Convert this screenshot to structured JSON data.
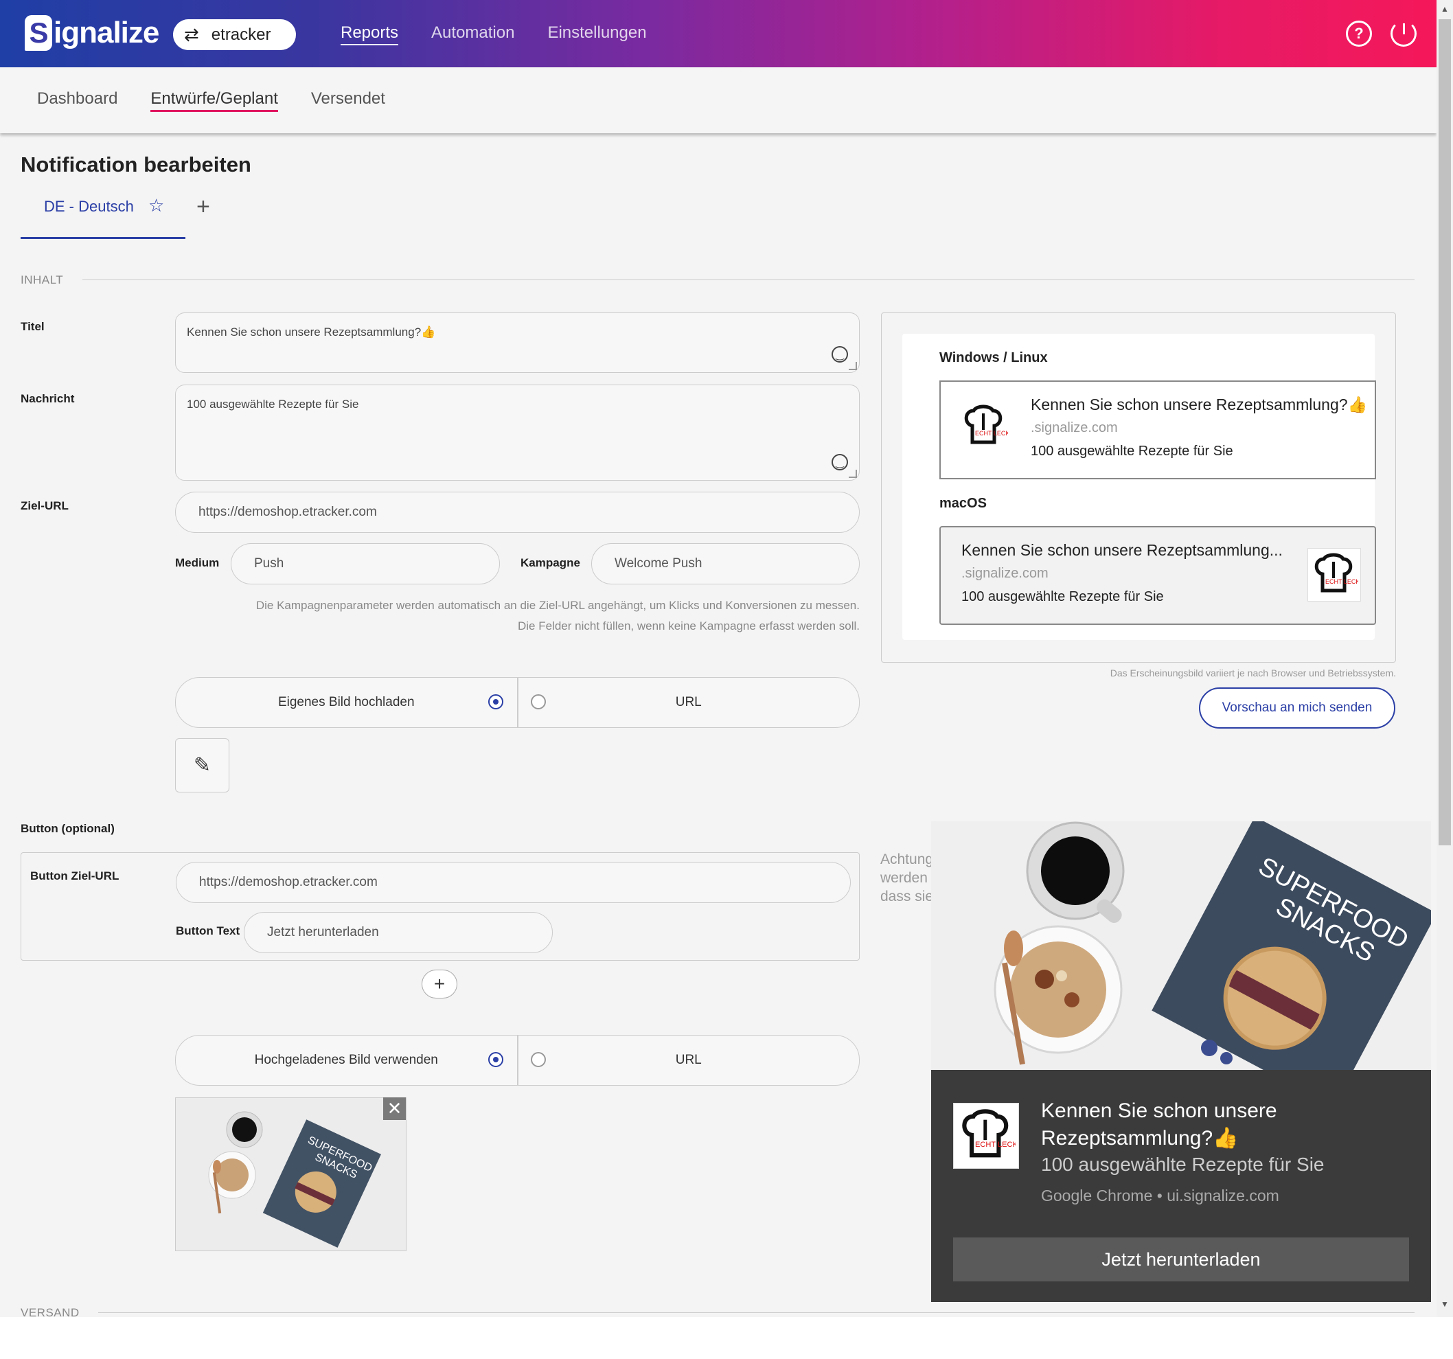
{
  "brand": {
    "logo_text": "ignalize",
    "logo_letter": "S",
    "account": "etracker",
    "swap_icon": "swap-arrows-icon"
  },
  "topnav": [
    {
      "label": "Reports",
      "active": true
    },
    {
      "label": "Automation"
    },
    {
      "label": "Einstellungen"
    }
  ],
  "topbar_icons": [
    "help-icon",
    "power-icon"
  ],
  "subnav": [
    {
      "label": "Dashboard"
    },
    {
      "label": "Entwürfe/Geplant",
      "active": true
    },
    {
      "label": "Versendet"
    }
  ],
  "page": {
    "title": "Notification bearbeiten",
    "language_tab": "DE - Deutsch",
    "add_language": "+"
  },
  "sections": {
    "content": "INHALT",
    "shipping": "VERSAND"
  },
  "form": {
    "title_label": "Titel",
    "title_value": "Kennen Sie schon unsere Rezeptsammlung?👍",
    "message_label": "Nachricht",
    "message_value": "100 ausgewählte Rezepte für Sie",
    "target_url_label": "Ziel-URL",
    "target_url_value": "https://demoshop.etracker.com",
    "medium_label": "Medium",
    "medium_value": "Push",
    "campaign_label": "Kampagne",
    "campaign_value": "Welcome Push",
    "help_line1": "Die Kampagnenparameter werden automatisch an die Ziel-URL angehängt, um Klicks und Konversionen zu messen.",
    "help_line2": "Die Felder nicht füllen, wenn keine Kampagne erfasst werden soll.",
    "icon_options": [
      "Eigenes Bild hochladen",
      "URL"
    ],
    "icon_selected": 0,
    "button_section_label": "Button (optional)",
    "button_url_label": "Button Ziel-URL",
    "button_url_value": "https://demoshop.etracker.com",
    "button_text_label": "Button Text",
    "button_text_value": "Jetzt herunterladen",
    "add_button": "+",
    "image_options": [
      "Hochgeladenes Bild verwenden",
      "URL"
    ],
    "image_selected": 0,
    "remove_image": "✕"
  },
  "preview": {
    "windows_label": "Windows / Linux",
    "mac_label": "macOS",
    "win_title": "Kennen Sie schon unsere Rezeptsammlung?👍",
    "mac_title": "Kennen Sie schon unsere Rezeptsammlung...",
    "site": ".signalize.com",
    "message": "100 ausgewählte Rezepte für Sie",
    "disclaimer": "Das Erscheinungsbild variiert je nach Browser und Betriebssystem.",
    "send_preview": "Vorschau an mich senden",
    "achtung": [
      "Achtung",
      "werden",
      "dass sie"
    ]
  },
  "rich_notification": {
    "title": "Kennen Sie schon unsere Rezeptsammlung?👍",
    "message": "100 ausgewählte Rezepte für Sie",
    "source": "Google Chrome • ui.signalize.com",
    "action": "Jetzt herunterladen"
  },
  "book": {
    "title_line1": "SUPERFOOD",
    "title_line2": "SNACKS"
  },
  "chef_logo": {
    "text": "ECHT LECKER"
  },
  "colors": {
    "accent": "#2b3fa6",
    "brand_pink": "#e0155f",
    "gradient_start": "#1f3fa6",
    "gradient_end": "#f5185a"
  }
}
